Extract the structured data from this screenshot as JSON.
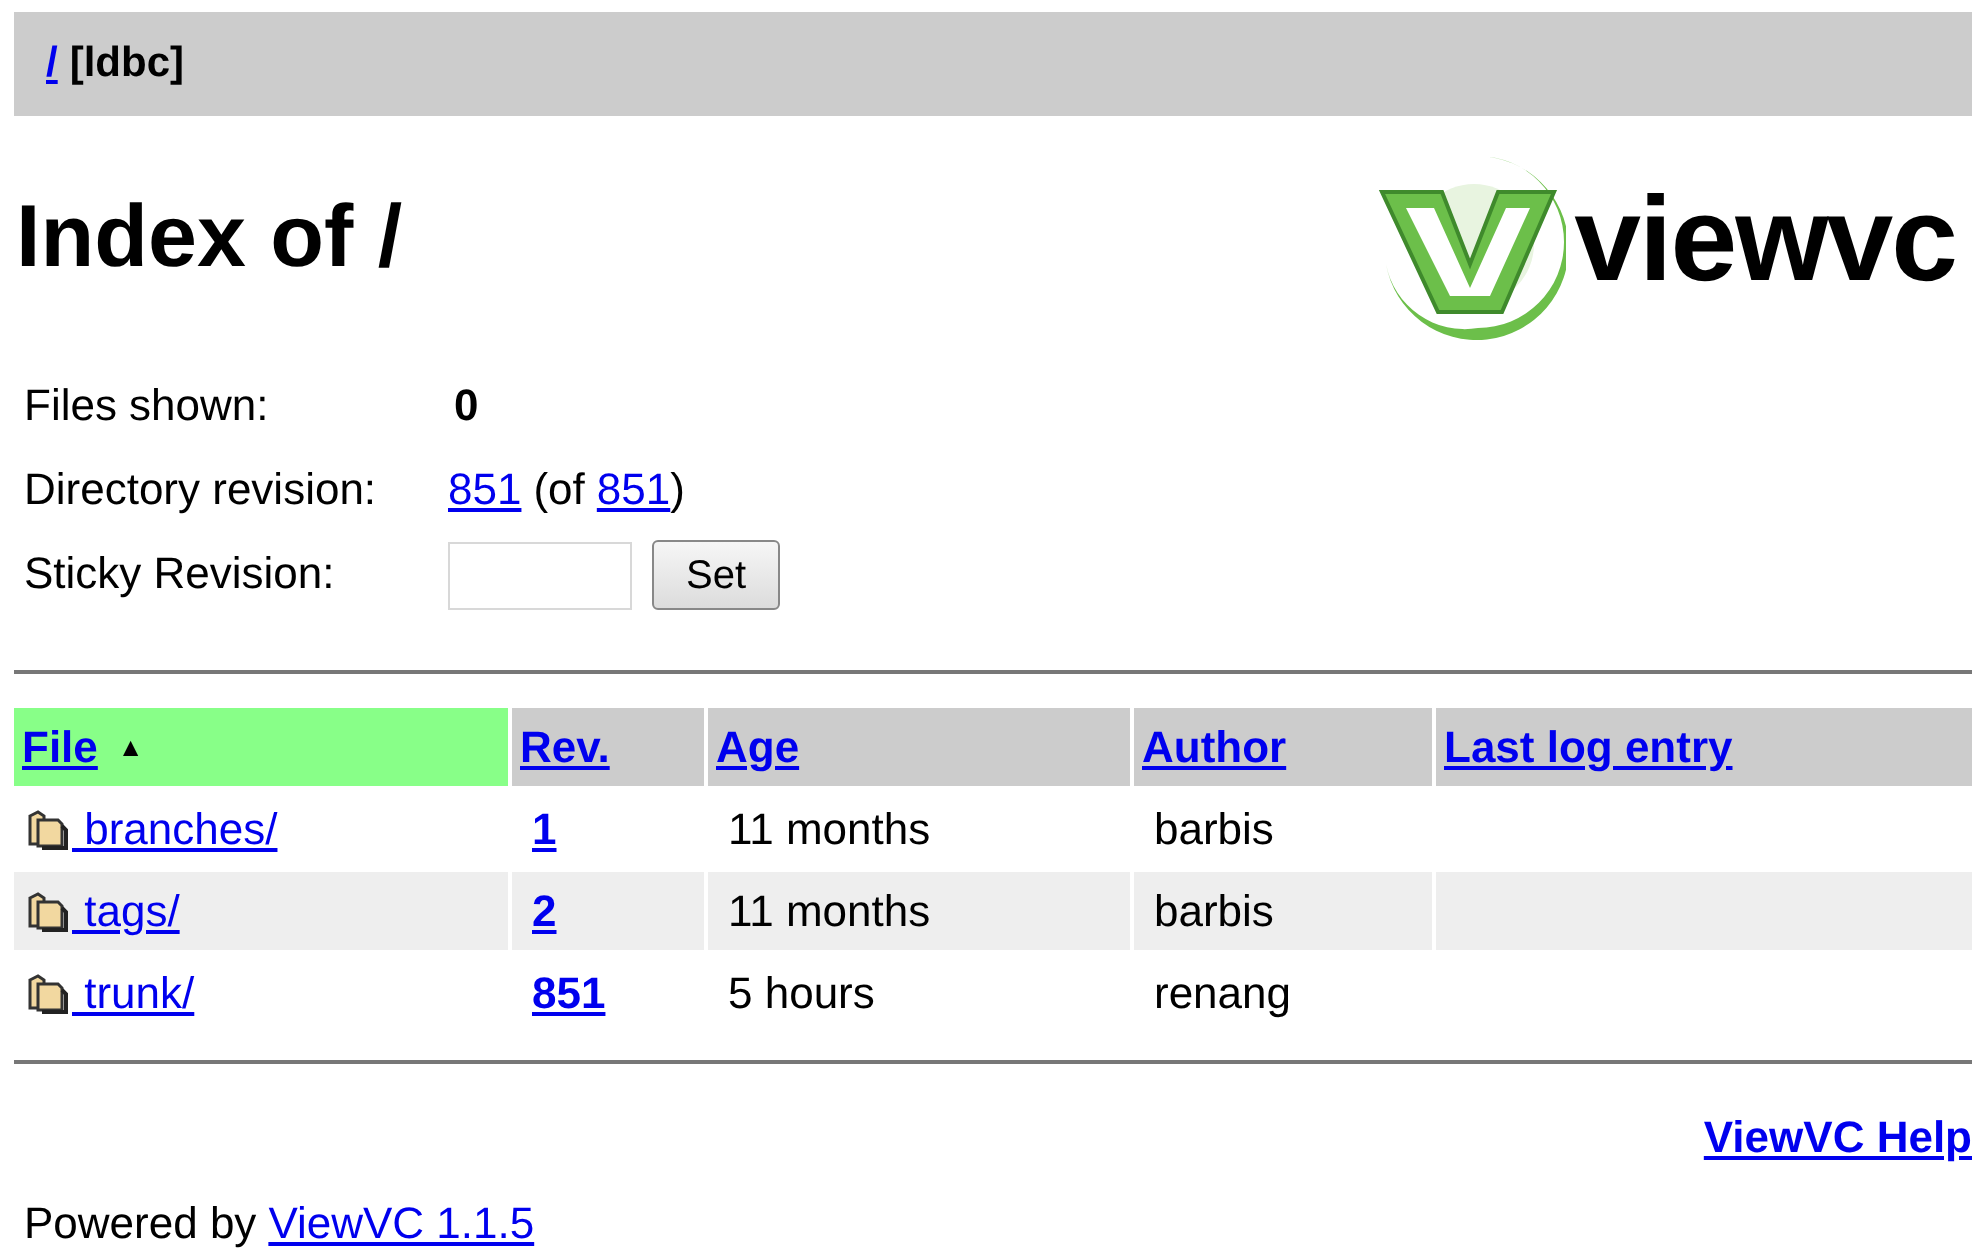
{
  "breadcrumb": {
    "link": "/",
    "repository": "[ldbc]"
  },
  "title": "Index of /",
  "logo": {
    "text": "viewvc"
  },
  "info": {
    "files_shown_label": "Files shown:",
    "files_shown": "0",
    "dir_rev_label": "Directory revision:",
    "dir_rev": "851",
    "dir_rev_of_open": "(of",
    "dir_rev_latest": "851",
    "dir_rev_close": ")",
    "sticky_label": "Sticky Revision:",
    "sticky_button": "Set"
  },
  "table": {
    "columns": [
      {
        "label": "File",
        "selected": true,
        "sort_arrow": "▲"
      },
      {
        "label": "Rev.",
        "selected": false
      },
      {
        "label": "Age",
        "selected": false
      },
      {
        "label": "Author",
        "selected": false
      },
      {
        "label": "Last log entry",
        "selected": false
      }
    ],
    "rows": [
      {
        "name": "branches/",
        "rev": "1",
        "age": "11 months",
        "author": "barbis"
      },
      {
        "name": "tags/",
        "rev": "2",
        "age": "11 months",
        "author": "barbis"
      },
      {
        "name": "trunk/",
        "rev": "851",
        "age": "5 hours",
        "author": "renang"
      }
    ]
  },
  "help_link": "ViewVC Help",
  "footer": {
    "text": "Powered by",
    "link": "ViewVC 1.1.5"
  }
}
